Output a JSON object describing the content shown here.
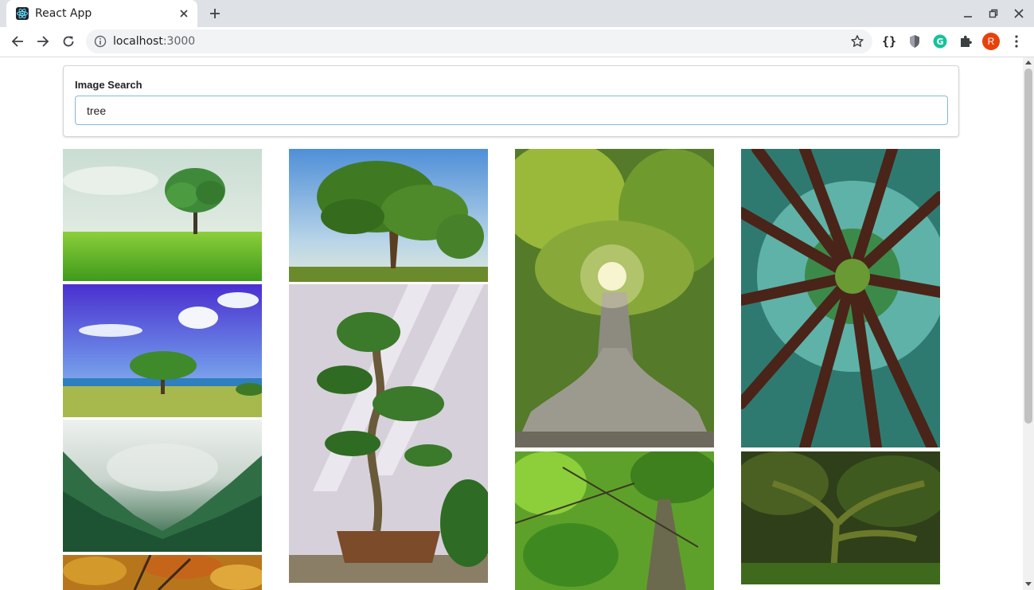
{
  "browser": {
    "tab_title": "React App",
    "url_host": "localhost",
    "url_port": ":3000",
    "profile_initial": "R",
    "icons": {
      "favicon": "react-icon",
      "tab_close": "close-icon",
      "new_tab": "plus-icon",
      "minimize": "minimize-icon",
      "restore": "restore-icon",
      "close_window": "close-icon",
      "back": "arrow-left-icon",
      "forward": "arrow-right-icon",
      "reload": "reload-icon",
      "site_info": "info-icon",
      "bookmark": "star-icon",
      "extensions": [
        "braces-icon",
        "shield-icon",
        "grammarly-icon",
        "puzzle-icon"
      ],
      "menu": "kebab-menu-icon"
    },
    "colors": {
      "tabstrip": "#dee1e6",
      "profile": "#e8410b",
      "grammarly": "#15c39a"
    }
  },
  "search": {
    "label": "Image Search",
    "value": "tree"
  },
  "results": {
    "query": "tree",
    "images": [
      {
        "name": "lone tree on green grass field"
      },
      {
        "name": "large spreading tree under sky"
      },
      {
        "name": "giant tree with buttress roots and sunburst"
      },
      {
        "name": "looking up at redwood canopy"
      },
      {
        "name": "tree on beach under blue sky"
      },
      {
        "name": "bonsai tree in pot"
      },
      {
        "name": "green leaves and tree trunk"
      },
      {
        "name": "mossy tree in forest"
      },
      {
        "name": "misty pine forest valley"
      },
      {
        "name": "autumn foliage"
      }
    ]
  }
}
